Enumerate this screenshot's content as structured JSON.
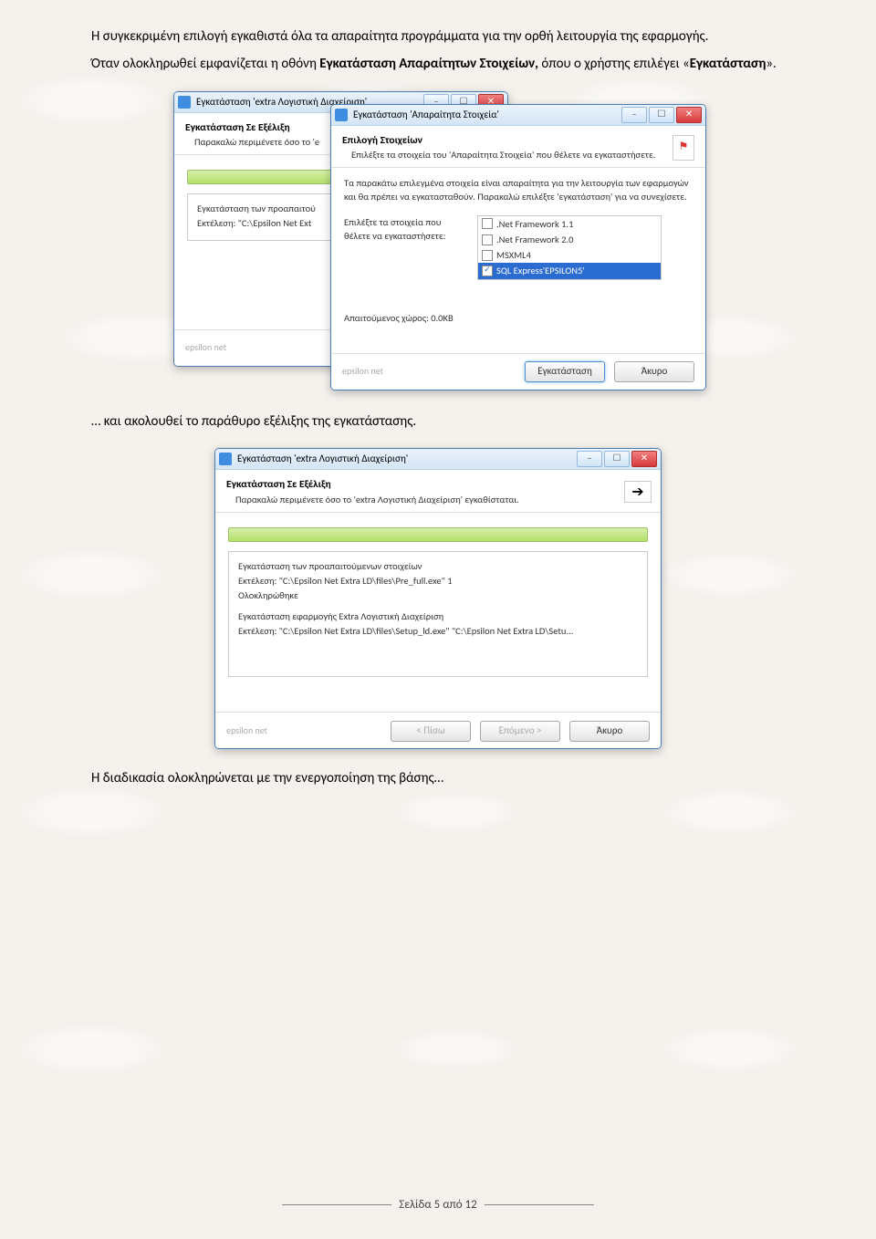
{
  "para1": "Η συγκεκριμένη επιλογή εγκαθιστά όλα τα απαραίτητα προγράμματα για την ορθή λειτουργία της εφαρμογής.",
  "para2a": "Όταν ολοκληρωθεί εμφανίζεται η οθόνη ",
  "para2b": "Εγκατάσταση Απαραίτητων Στοιχείων,",
  "para2c": " όπου ο χρήστης επιλέγει «",
  "para2d": "Εγκατάσταση",
  "para2e": "».",
  "para3": "… και ακολουθεί το παράθυρο εξέλιξης της εγκατάστασης.",
  "para4": "Η διαδικασία ολοκληρώνεται με την ενεργοποίηση της βάσης…",
  "footer": "Σελίδα 5 από 12",
  "winA": {
    "title": "Εγκατάσταση 'extra Λογιστική Διαχείριση'",
    "h1": "Εγκατάσταση Σε Εξέλιξη",
    "h2": "Παρακαλώ περιμένετε όσο το 'e",
    "s1": "Εγκατάσταση των προαπαιτού",
    "s2": "Εκτέλεση: \"C:\\Epsilon Net Ext",
    "brand": "epsilon net"
  },
  "winB": {
    "title": "Εγκατάσταση 'Απαραίτητα Στοιχεία'",
    "h1": "Επιλογή Στοιχείων",
    "h2": "Επιλέξτε τα στοιχεία του 'Απαραίτητα Στοιχεία' που θέλετε να εγκαταστήσετε.",
    "desc": "Τα παρακάτω επιλεγμένα στοιχεία είναι απαραίτητα για την λειτουργία των εφαρμογών και θα πρέπει να εγκατασταθούν. Παρακαλώ επιλέξτε 'εγκατάσταση' για να συνεχίσετε.",
    "leftlbl": "Επιλέξτε τα στοιχεία που θέλετε να εγκαταστήσετε:",
    "items": [
      {
        "label": ".Net Framework 1.1",
        "checked": false
      },
      {
        "label": ".Net Framework 2.0",
        "checked": false
      },
      {
        "label": "MSXML4",
        "checked": false
      },
      {
        "label": "SQL Express'EPSILON5'",
        "checked": true,
        "sel": true
      }
    ],
    "space": "Απαιτούμενος χώρος: 0.0KB",
    "brand": "epsilon net",
    "btnInstall": "Εγκατάσταση",
    "btnCancel": "Άκυρο"
  },
  "winC": {
    "title": "Εγκατάσταση 'extra Λογιστική Διαχείριση'",
    "h1": "Εγκατάσταση Σε Εξέλιξη",
    "h2": "Παρακαλώ περιμένετε όσο το 'extra Λογιστική Διαχείριση' εγκαθίσταται.",
    "arrow": "➔",
    "l1": "Εγκατάσταση των προαπαιτούμενων στοιχείων",
    "l2": "Εκτέλεση: \"C:\\Epsilon Net Extra LD\\files\\Pre_full.exe\" 1",
    "l3": "Ολοκληρώθηκε",
    "l4": "Εγκατάσταση εφαρμογής Extra Λογιστική Διαχείριση",
    "l5": "Εκτέλεση: \"C:\\Epsilon Net Extra LD\\files\\Setup_ld.exe\" \"C:\\Epsilon Net Extra LD\\Setu...",
    "brand": "epsilon net",
    "btnBack": "< Πίσω",
    "btnNext": "Επόμενο >",
    "btnCancel": "Άκυρο"
  }
}
